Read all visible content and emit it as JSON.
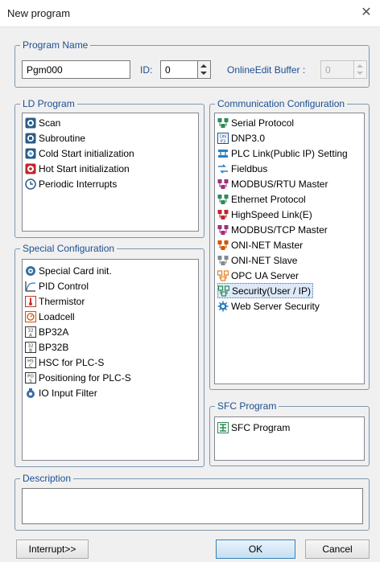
{
  "window": {
    "title": "New program",
    "close_glyph": "✕"
  },
  "program_name": {
    "group_label": "Program Name",
    "name_value": "Pgm000",
    "id_label": "ID:",
    "id_value": "0",
    "online_edit_label": "OnlineEdit Buffer :",
    "online_edit_value": "0"
  },
  "ld_program": {
    "group_label": "LD Program",
    "items": [
      {
        "label": "Scan",
        "icon": "scan-icon"
      },
      {
        "label": "Subroutine",
        "icon": "subroutine-icon"
      },
      {
        "label": "Cold Start initialization",
        "icon": "cold-start-icon"
      },
      {
        "label": "Hot Start initialization",
        "icon": "hot-start-icon"
      },
      {
        "label": "Periodic Interrupts",
        "icon": "clock-icon"
      }
    ]
  },
  "special_configuration": {
    "group_label": "Special Configuration",
    "items": [
      {
        "label": "Special Card init.",
        "icon": "special-card-icon"
      },
      {
        "label": "PID Control",
        "icon": "pid-icon"
      },
      {
        "label": "Thermistor",
        "icon": "thermistor-icon"
      },
      {
        "label": "Loadcell",
        "icon": "loadcell-icon"
      },
      {
        "label": "BP32A",
        "icon": "bp32a-icon"
      },
      {
        "label": "BP32B",
        "icon": "bp32b-icon"
      },
      {
        "label": "HSC for PLC-S",
        "icon": "hsc-icon"
      },
      {
        "label": "Positioning for PLC-S",
        "icon": "positioning-icon"
      },
      {
        "label": "IO Input Filter",
        "icon": "filter-icon"
      }
    ]
  },
  "communication_configuration": {
    "group_label": "Communication Configuration",
    "selected_index": 12,
    "items": [
      {
        "label": "Serial Protocol",
        "icon": "serial-icon"
      },
      {
        "label": "DNP3.0",
        "icon": "dnp-icon"
      },
      {
        "label": "PLC Link(Public IP) Setting",
        "icon": "plc-link-icon"
      },
      {
        "label": "Fieldbus",
        "icon": "fieldbus-icon"
      },
      {
        "label": "MODBUS/RTU Master",
        "icon": "modbus-rtu-icon"
      },
      {
        "label": "Ethernet Protocol",
        "icon": "ethernet-icon"
      },
      {
        "label": "HighSpeed Link(E)",
        "icon": "highspeed-link-icon"
      },
      {
        "label": "MODBUS/TCP Master",
        "icon": "modbus-tcp-icon"
      },
      {
        "label": "ONI-NET Master",
        "icon": "oni-master-icon"
      },
      {
        "label": "ONI-NET Slave",
        "icon": "oni-slave-icon"
      },
      {
        "label": "OPC UA Server",
        "icon": "opc-ua-icon"
      },
      {
        "label": "Security(User / IP)",
        "icon": "security-icon"
      },
      {
        "label": "Web Server Security",
        "icon": "web-security-icon"
      }
    ]
  },
  "sfc_program": {
    "group_label": "SFC Program",
    "items": [
      {
        "label": "SFC Program",
        "icon": "sfc-icon"
      }
    ]
  },
  "description": {
    "group_label": "Description",
    "value": ""
  },
  "buttons": {
    "interrupt": "Interrupt>>",
    "ok": "OK",
    "cancel": "Cancel"
  },
  "colors": {
    "group_label": "#1d4f91",
    "group_border": "#7e98b0",
    "selection": "#dde9f8",
    "default_button": "#c5dff3"
  }
}
